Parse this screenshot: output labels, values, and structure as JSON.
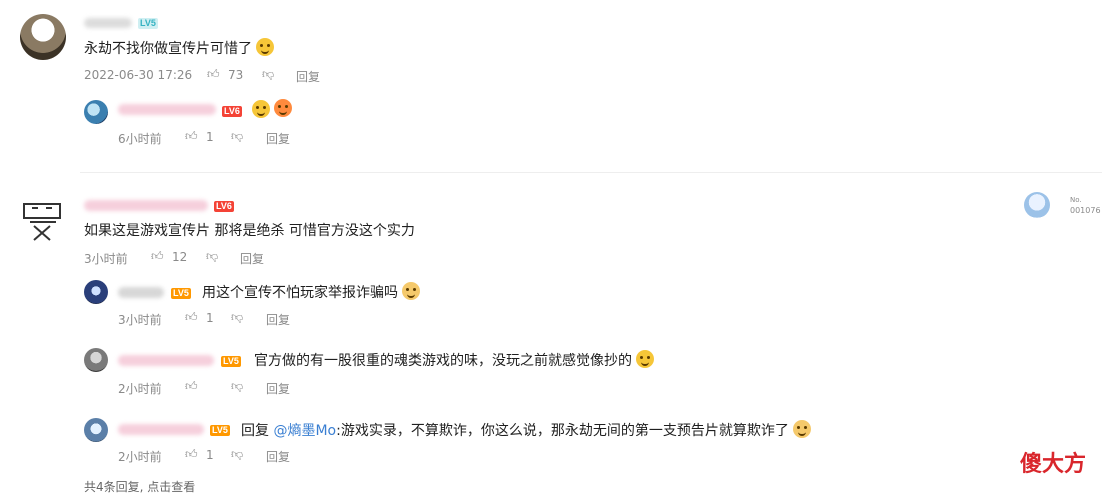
{
  "comments": [
    {
      "text": "永劫不找你做宣传片可惜了",
      "date": "2022-06-30 17:26",
      "likes": "73",
      "reply_label": "回复",
      "replies": [
        {
          "time": "6小时前",
          "likes": "1",
          "reply_label": "回复"
        }
      ]
    },
    {
      "text": "如果这是游戏宣传片 那将是绝杀 可惜官方没这个实力",
      "time": "3小时前",
      "likes": "12",
      "reply_label": "回复",
      "side_badge": {
        "no_label": "No.",
        "number": "001076"
      },
      "replies": [
        {
          "text": "用这个宣传不怕玩家举报诈骗吗",
          "time": "3小时前",
          "likes": "1",
          "reply_label": "回复"
        },
        {
          "text": "官方做的有一股很重的魂类游戏的味，没玩之前就感觉像抄的",
          "time": "2小时前",
          "likes": "",
          "reply_label": "回复"
        },
        {
          "reply_prefix": "回复",
          "mention": "@熵墨Mo",
          "text": ":游戏实录，不算欺诈，你这么说，那永劫无间的第一支预告片就算欺诈了",
          "time": "2小时前",
          "likes": "1",
          "reply_label": "回复"
        }
      ],
      "footer": "共4条回复, 点击查看"
    }
  ],
  "level_badges": {
    "lv5": "LV5",
    "lv6": "LV6"
  },
  "watermark": "傻大方",
  "colors": {
    "link": "#3a7fd2",
    "meta": "#8a8a8a",
    "badge_red": "#f44336",
    "badge_orange": "#ff9800",
    "watermark_red": "#d9262c"
  }
}
